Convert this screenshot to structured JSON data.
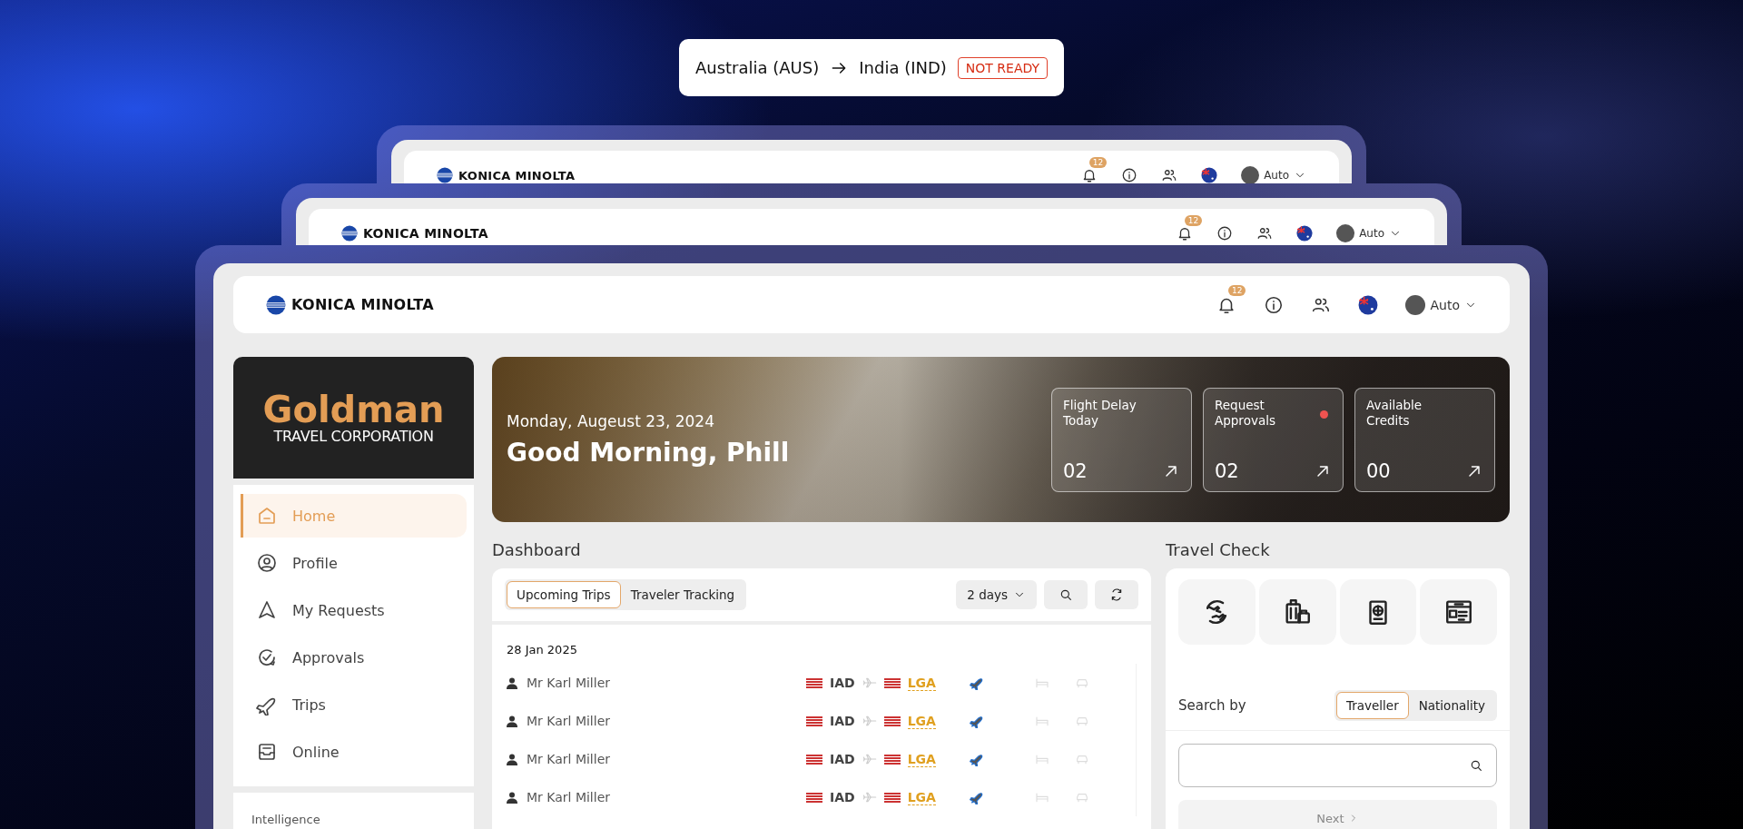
{
  "route_banner": {
    "origin": "Australia (AUS)",
    "destination": "India (IND)",
    "status": "NOT READY"
  },
  "headers": [
    {
      "logo": "KONICA MINOLTA",
      "notifications": "12",
      "user": "Auto"
    },
    {
      "logo": "KONICA MINOLTA",
      "notifications": "12",
      "user": "Auto"
    },
    {
      "logo": "KONICA MINOLTA",
      "notifications": "12",
      "user": "Auto"
    }
  ],
  "sidebar": {
    "brand": {
      "name": "Goldman",
      "tagline": "TRAVEL CORPORATION"
    },
    "items": [
      {
        "label": "Home",
        "kind": "home",
        "selected": true
      },
      {
        "label": "Profile",
        "kind": "profile",
        "selected": false
      },
      {
        "label": "My Requests",
        "kind": "requests",
        "selected": false
      },
      {
        "label": "Approvals",
        "kind": "approvals",
        "selected": false
      },
      {
        "label": "Trips",
        "kind": "trips",
        "selected": false
      },
      {
        "label": "Online",
        "kind": "online",
        "selected": false
      }
    ],
    "section": "Intelligence"
  },
  "hero": {
    "date": "Monday, Augeust 23, 2024",
    "greeting": "Good Morning, Phill",
    "stats": [
      {
        "label": "Flight Delay Today",
        "value": "02",
        "alert": false
      },
      {
        "label": "Request Approvals",
        "value": "02",
        "alert": true
      },
      {
        "label": "Available Credits",
        "value": "00",
        "alert": false
      }
    ]
  },
  "dashboard": {
    "title": "Dashboard",
    "tabs": [
      {
        "label": "Upcoming Trips",
        "selected": true
      },
      {
        "label": "Traveler Tracking",
        "selected": false
      }
    ],
    "filter": "2 days",
    "date_group": "28 Jan 2025",
    "rows": [
      {
        "traveler": "Mr Karl Miller",
        "origin": "IAD",
        "destination": "LGA",
        "flight": true,
        "hotel": false,
        "car": false
      },
      {
        "traveler": "Mr Karl Miller",
        "origin": "IAD",
        "destination": "LGA",
        "flight": true,
        "hotel": false,
        "car": false
      },
      {
        "traveler": "Mr Karl Miller",
        "origin": "IAD",
        "destination": "LGA",
        "flight": true,
        "hotel": false,
        "car": false
      },
      {
        "traveler": "Mr Karl Miller",
        "origin": "IAD",
        "destination": "LGA",
        "flight": true,
        "hotel": false,
        "car": false
      }
    ]
  },
  "travel_check": {
    "title": "Travel Check",
    "tiles": [
      {
        "kind": "flights"
      },
      {
        "kind": "baggage"
      },
      {
        "kind": "passport"
      },
      {
        "kind": "visa"
      }
    ],
    "search_by": "Search by",
    "tabs": [
      {
        "label": "Traveller",
        "selected": true
      },
      {
        "label": "Nationality",
        "selected": false
      }
    ],
    "next_button": {
      "label": "Next",
      "disabled": true
    }
  }
}
